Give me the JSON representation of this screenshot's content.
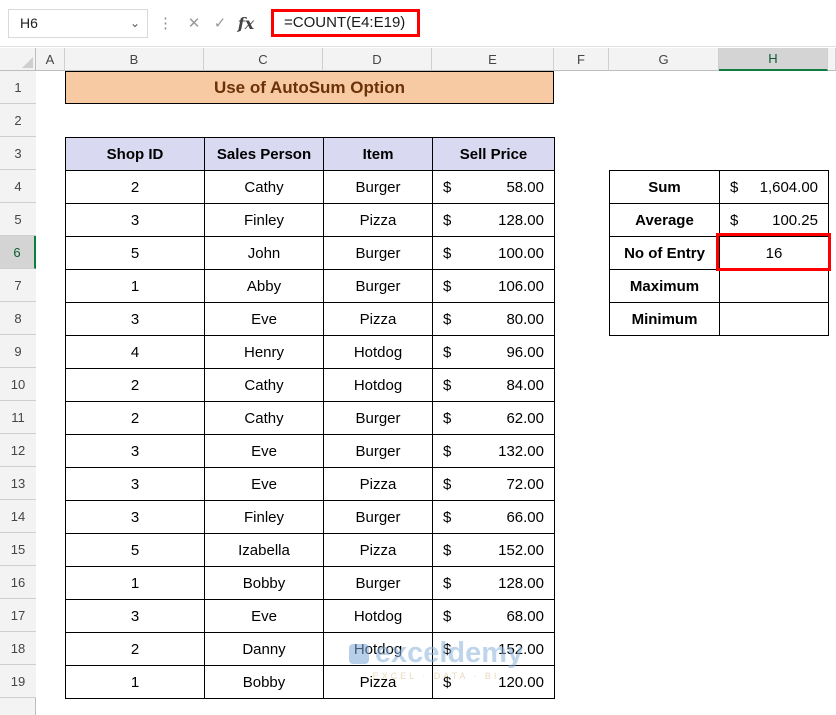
{
  "formula_bar": {
    "name_box": "H6",
    "formula": "=COUNT(E4:E19)",
    "icons": {
      "chevron": "⌄",
      "kebab": "⋮",
      "cancel": "✕",
      "enter": "✓",
      "function": "fx"
    }
  },
  "sheet": {
    "column_headers": [
      "A",
      "B",
      "C",
      "D",
      "E",
      "F",
      "G",
      "H"
    ],
    "selected_column": "H",
    "row_headers": [
      "1",
      "2",
      "3",
      "4",
      "5",
      "6",
      "7",
      "8",
      "9",
      "10",
      "11",
      "12",
      "13",
      "14",
      "15",
      "16",
      "17",
      "18",
      "19"
    ],
    "selected_row": "6",
    "title": "Use of AutoSum Option",
    "data_table": {
      "currency": "$",
      "headers": [
        "Shop ID",
        "Sales Person",
        "Item",
        "Sell Price"
      ],
      "rows": [
        [
          "2",
          "Cathy",
          "Burger",
          "58.00"
        ],
        [
          "3",
          "Finley",
          "Pizza",
          "128.00"
        ],
        [
          "5",
          "John",
          "Burger",
          "100.00"
        ],
        [
          "1",
          "Abby",
          "Burger",
          "106.00"
        ],
        [
          "3",
          "Eve",
          "Pizza",
          "80.00"
        ],
        [
          "4",
          "Henry",
          "Hotdog",
          "96.00"
        ],
        [
          "2",
          "Cathy",
          "Hotdog",
          "84.00"
        ],
        [
          "2",
          "Cathy",
          "Burger",
          "62.00"
        ],
        [
          "3",
          "Eve",
          "Burger",
          "132.00"
        ],
        [
          "3",
          "Eve",
          "Pizza",
          "72.00"
        ],
        [
          "3",
          "Finley",
          "Burger",
          "66.00"
        ],
        [
          "5",
          "Izabella",
          "Pizza",
          "152.00"
        ],
        [
          "1",
          "Bobby",
          "Burger",
          "128.00"
        ],
        [
          "3",
          "Eve",
          "Hotdog",
          "68.00"
        ],
        [
          "2",
          "Danny",
          "Hotdog",
          "152.00"
        ],
        [
          "1",
          "Bobby",
          "Pizza",
          "120.00"
        ]
      ]
    },
    "summary_table": {
      "rows": [
        {
          "label": "Sum",
          "currency": "$",
          "value": "1,604.00",
          "highlight": false
        },
        {
          "label": "Average",
          "currency": "$",
          "value": "100.25",
          "highlight": false
        },
        {
          "label": "No of Entry",
          "currency": "",
          "value": "16",
          "highlight": true
        },
        {
          "label": "Maximum",
          "currency": "",
          "value": "",
          "highlight": false
        },
        {
          "label": "Minimum",
          "currency": "",
          "value": "",
          "highlight": false
        }
      ]
    },
    "watermark": {
      "brand": "exceldemy",
      "tagline": "EXCEL · DATA · BI"
    }
  },
  "colors": {
    "title_fill": "#F7CAA4",
    "table_header_fill": "#D9D9F2",
    "selection_green": "#107C41",
    "annotation_red": "#FF0000",
    "watermark_blue": "#8AB4DC"
  }
}
